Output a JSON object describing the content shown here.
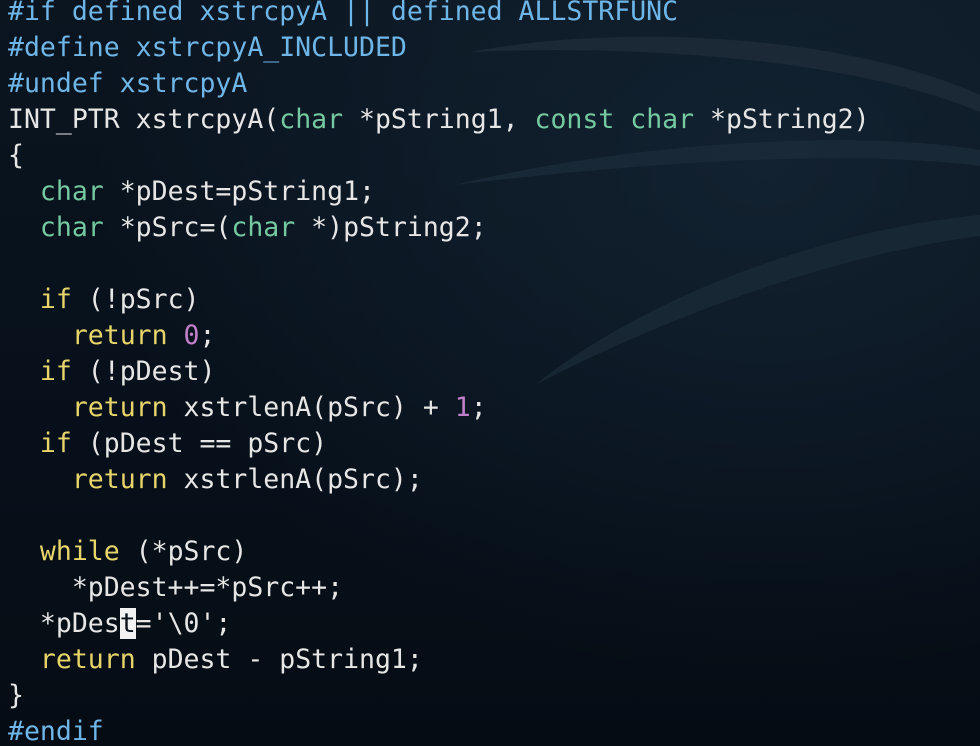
{
  "window": {
    "background": "#081019",
    "colors": {
      "preprocessor": "#6fb6e8",
      "type": "#74c9a0",
      "keyword": "#e8d56a",
      "number": "#c07fc8",
      "text": "#e6e6e6",
      "cursor_bg": "#f2f2f2"
    }
  },
  "lines": [
    [
      {
        "t": "#if defined xstrcpyA || defined ALLSTRFUNC",
        "c": "pp"
      }
    ],
    [
      {
        "t": "#define xstrcpyA_INCLUDED",
        "c": "pp"
      }
    ],
    [
      {
        "t": "#undef xstrcpyA",
        "c": "pp"
      }
    ],
    [
      {
        "t": "INT_PTR xstrcpyA(",
        "c": ""
      },
      {
        "t": "char",
        "c": "ty"
      },
      {
        "t": " *pString1, ",
        "c": ""
      },
      {
        "t": "const",
        "c": "ty"
      },
      {
        "t": " ",
        "c": ""
      },
      {
        "t": "char",
        "c": "ty"
      },
      {
        "t": " *pString2)",
        "c": ""
      }
    ],
    [
      {
        "t": "{",
        "c": ""
      }
    ],
    [
      {
        "t": "  ",
        "c": ""
      },
      {
        "t": "char",
        "c": "ty"
      },
      {
        "t": " *pDest=pString1;",
        "c": ""
      }
    ],
    [
      {
        "t": "  ",
        "c": ""
      },
      {
        "t": "char",
        "c": "ty"
      },
      {
        "t": " *pSrc=(",
        "c": ""
      },
      {
        "t": "char",
        "c": "ty"
      },
      {
        "t": " *)pString2;",
        "c": ""
      }
    ],
    [
      {
        "t": "",
        "c": ""
      }
    ],
    [
      {
        "t": "  ",
        "c": ""
      },
      {
        "t": "if",
        "c": "kw"
      },
      {
        "t": " (!pSrc)",
        "c": ""
      }
    ],
    [
      {
        "t": "    ",
        "c": ""
      },
      {
        "t": "return",
        "c": "kw"
      },
      {
        "t": " ",
        "c": ""
      },
      {
        "t": "0",
        "c": "num"
      },
      {
        "t": ";",
        "c": ""
      }
    ],
    [
      {
        "t": "  ",
        "c": ""
      },
      {
        "t": "if",
        "c": "kw"
      },
      {
        "t": " (!pDest)",
        "c": ""
      }
    ],
    [
      {
        "t": "    ",
        "c": ""
      },
      {
        "t": "return",
        "c": "kw"
      },
      {
        "t": " xstrlenA(pSrc) + ",
        "c": ""
      },
      {
        "t": "1",
        "c": "num"
      },
      {
        "t": ";",
        "c": ""
      }
    ],
    [
      {
        "t": "  ",
        "c": ""
      },
      {
        "t": "if",
        "c": "kw"
      },
      {
        "t": " (pDest == pSrc)",
        "c": ""
      }
    ],
    [
      {
        "t": "    ",
        "c": ""
      },
      {
        "t": "return",
        "c": "kw"
      },
      {
        "t": " xstrlenA(pSrc);",
        "c": ""
      }
    ],
    [
      {
        "t": "",
        "c": ""
      }
    ],
    [
      {
        "t": "  ",
        "c": ""
      },
      {
        "t": "while",
        "c": "kw"
      },
      {
        "t": " (*pSrc)",
        "c": ""
      }
    ],
    [
      {
        "t": "    *pDest++=*pSrc++;",
        "c": ""
      }
    ],
    [
      {
        "t": "  *pDes",
        "c": ""
      },
      {
        "t": "t",
        "c": "cursor"
      },
      {
        "t": "='\\0';",
        "c": ""
      }
    ],
    [
      {
        "t": "  ",
        "c": ""
      },
      {
        "t": "return",
        "c": "kw"
      },
      {
        "t": " pDest - pString1;",
        "c": ""
      }
    ],
    [
      {
        "t": "}",
        "c": ""
      }
    ],
    [
      {
        "t": "#endif",
        "c": "pp"
      }
    ]
  ]
}
